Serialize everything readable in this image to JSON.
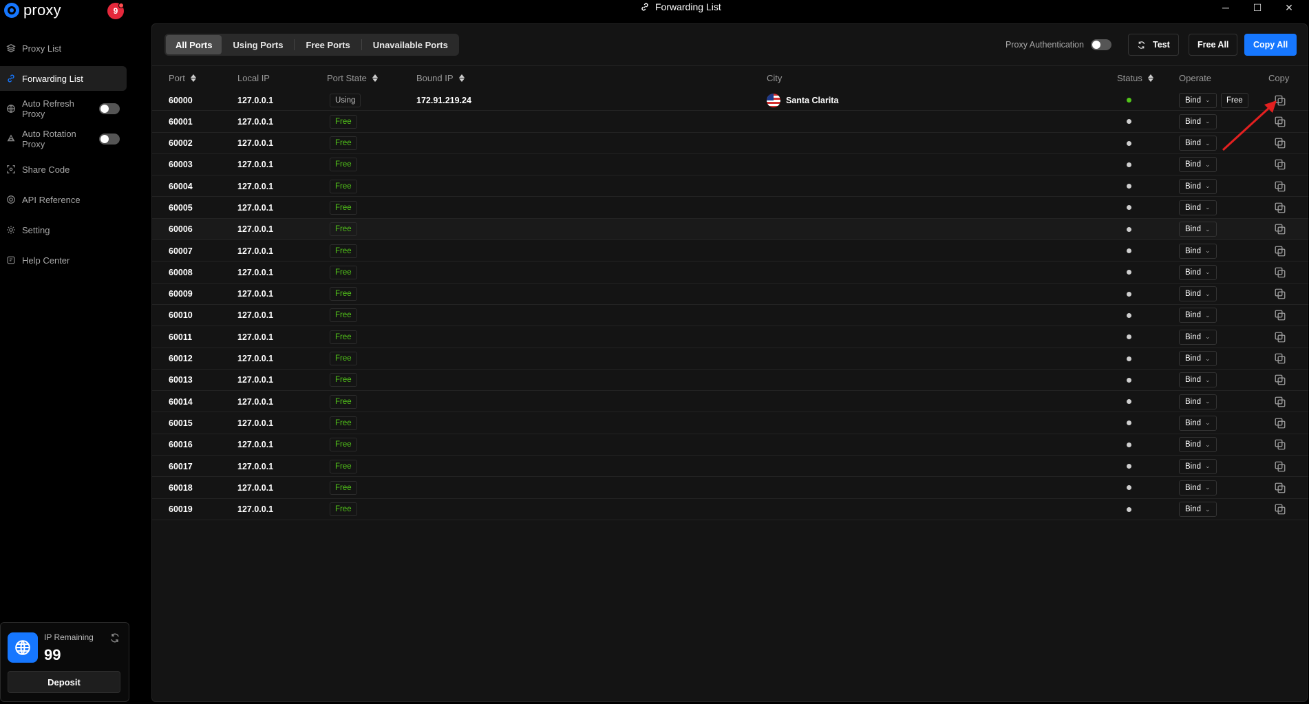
{
  "app": {
    "name": "proxy",
    "notifications": "9",
    "window_title": "Forwarding List",
    "accent": "#1677ff"
  },
  "sidebar": {
    "items": [
      {
        "label": "Proxy List",
        "icon": "layers-icon"
      },
      {
        "label": "Forwarding List",
        "icon": "link-icon",
        "active": true
      },
      {
        "label": "Auto Refresh Proxy",
        "icon": "globe-icon",
        "toggle": false
      },
      {
        "label": "Auto Rotation Proxy",
        "icon": "rotation-icon",
        "toggle": false
      },
      {
        "label": "Share Code",
        "icon": "share-icon"
      },
      {
        "label": "API Reference",
        "icon": "api-icon"
      },
      {
        "label": "Setting",
        "icon": "gear-icon"
      },
      {
        "label": "Help Center",
        "icon": "help-icon"
      }
    ],
    "ip_card": {
      "label": "IP Remaining",
      "count": "99",
      "deposit_label": "Deposit"
    }
  },
  "toolbar": {
    "tabs": [
      "All Ports",
      "Using Ports",
      "Free Ports",
      "Unavailable Ports"
    ],
    "active_tab": "All Ports",
    "auth_label": "Proxy Authentication",
    "test_label": "Test",
    "free_all_label": "Free All",
    "copy_all_label": "Copy All"
  },
  "table": {
    "columns": {
      "port": "Port",
      "local_ip": "Local IP",
      "port_state": "Port State",
      "bound_ip": "Bound IP",
      "city": "City",
      "status": "Status",
      "operate": "Operate",
      "copy": "Copy"
    },
    "bind_label": "Bind",
    "free_label": "Free",
    "rows": [
      {
        "port": "60000",
        "local_ip": "127.0.0.1",
        "state": "Using",
        "bound_ip": "172.91.219.24",
        "city": "Santa Clarita",
        "status": "online"
      },
      {
        "port": "60001",
        "local_ip": "127.0.0.1",
        "state": "Free",
        "bound_ip": "",
        "city": "",
        "status": "idle"
      },
      {
        "port": "60002",
        "local_ip": "127.0.0.1",
        "state": "Free",
        "bound_ip": "",
        "city": "",
        "status": "idle"
      },
      {
        "port": "60003",
        "local_ip": "127.0.0.1",
        "state": "Free",
        "bound_ip": "",
        "city": "",
        "status": "idle"
      },
      {
        "port": "60004",
        "local_ip": "127.0.0.1",
        "state": "Free",
        "bound_ip": "",
        "city": "",
        "status": "idle"
      },
      {
        "port": "60005",
        "local_ip": "127.0.0.1",
        "state": "Free",
        "bound_ip": "",
        "city": "",
        "status": "idle"
      },
      {
        "port": "60006",
        "local_ip": "127.0.0.1",
        "state": "Free",
        "bound_ip": "",
        "city": "",
        "status": "idle"
      },
      {
        "port": "60007",
        "local_ip": "127.0.0.1",
        "state": "Free",
        "bound_ip": "",
        "city": "",
        "status": "idle"
      },
      {
        "port": "60008",
        "local_ip": "127.0.0.1",
        "state": "Free",
        "bound_ip": "",
        "city": "",
        "status": "idle"
      },
      {
        "port": "60009",
        "local_ip": "127.0.0.1",
        "state": "Free",
        "bound_ip": "",
        "city": "",
        "status": "idle"
      },
      {
        "port": "60010",
        "local_ip": "127.0.0.1",
        "state": "Free",
        "bound_ip": "",
        "city": "",
        "status": "idle"
      },
      {
        "port": "60011",
        "local_ip": "127.0.0.1",
        "state": "Free",
        "bound_ip": "",
        "city": "",
        "status": "idle"
      },
      {
        "port": "60012",
        "local_ip": "127.0.0.1",
        "state": "Free",
        "bound_ip": "",
        "city": "",
        "status": "idle"
      },
      {
        "port": "60013",
        "local_ip": "127.0.0.1",
        "state": "Free",
        "bound_ip": "",
        "city": "",
        "status": "idle"
      },
      {
        "port": "60014",
        "local_ip": "127.0.0.1",
        "state": "Free",
        "bound_ip": "",
        "city": "",
        "status": "idle"
      },
      {
        "port": "60015",
        "local_ip": "127.0.0.1",
        "state": "Free",
        "bound_ip": "",
        "city": "",
        "status": "idle"
      },
      {
        "port": "60016",
        "local_ip": "127.0.0.1",
        "state": "Free",
        "bound_ip": "",
        "city": "",
        "status": "idle"
      },
      {
        "port": "60017",
        "local_ip": "127.0.0.1",
        "state": "Free",
        "bound_ip": "",
        "city": "",
        "status": "idle"
      },
      {
        "port": "60018",
        "local_ip": "127.0.0.1",
        "state": "Free",
        "bound_ip": "",
        "city": "",
        "status": "idle"
      },
      {
        "port": "60019",
        "local_ip": "127.0.0.1",
        "state": "Free",
        "bound_ip": "",
        "city": "",
        "status": "idle"
      }
    ]
  }
}
